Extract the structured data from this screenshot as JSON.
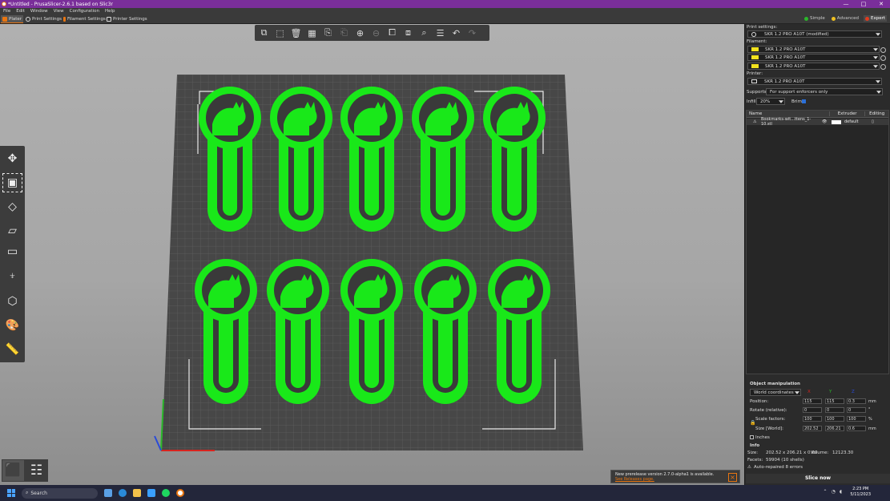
{
  "window": {
    "title": "*Untitled - PrusaSlicer-2.6.1 based on Slic3r",
    "controls": [
      "—",
      "□",
      "✕"
    ]
  },
  "menu": [
    "File",
    "Edit",
    "Window",
    "View",
    "Configuration",
    "Help"
  ],
  "tabs": [
    {
      "label": "Plater",
      "color": "#e87511"
    },
    {
      "label": "Print Settings",
      "color": "#dddddd"
    },
    {
      "label": "Filament Settings",
      "color": "#e87511"
    },
    {
      "label": "Printer Settings",
      "color": "#dddddd"
    }
  ],
  "modes": [
    {
      "label": "Simple",
      "color": "#2ab72a"
    },
    {
      "label": "Advanced",
      "color": "#f0c020"
    },
    {
      "label": "Expert",
      "color": "#e03a1e"
    }
  ],
  "print_settings": {
    "label": "Print settings:",
    "value": "SKR 1.2 PRO A10T (modified)"
  },
  "filament": {
    "label": "Filament:",
    "items": [
      "SKR 1.2 PRO A10T",
      "SKR 1.2 PRO A10T",
      "SKR 1.2 PRO A10T"
    ],
    "color": "#f2e21e"
  },
  "printer": {
    "label": "Printer:",
    "value": "SKR 1.2 PRO A10T"
  },
  "supports": {
    "label": "Supports:",
    "value": "For support enforcers only"
  },
  "infill": {
    "label": "Infill:",
    "value": "20%"
  },
  "brim": {
    "label": "Brim:",
    "checked": true
  },
  "object_list": {
    "columns": [
      "Name",
      "Extruder",
      "Editing"
    ],
    "rows": [
      {
        "name": "Bookmarks-wit...ttens_1-10.stl",
        "extruder": "default"
      }
    ]
  },
  "object_manipulation": {
    "title": "Object manipulation",
    "coord_system": "World coordinates",
    "axes": [
      "X",
      "Y",
      "Z"
    ],
    "rows": [
      {
        "label": "Position:",
        "values": [
          "115",
          "115",
          "0.3"
        ],
        "unit": "mm"
      },
      {
        "label": "Rotate (relative):",
        "values": [
          "0",
          "0",
          "0"
        ],
        "unit": "°"
      },
      {
        "label": "Scale factors:",
        "values": [
          "100",
          "100",
          "100"
        ],
        "unit": "%"
      },
      {
        "label": "Size [World]:",
        "values": [
          "202.52",
          "206.21",
          "0.6"
        ],
        "unit": "mm"
      }
    ],
    "inches_label": "Inches"
  },
  "info": {
    "title": "Info",
    "size_label": "Size:",
    "size_value": "202.52 x 206.21 x 0.60",
    "volume_label": "Volume:",
    "volume_value": "12123.30",
    "facets_label": "Facets:",
    "facets_value": "59904 (10 shells)",
    "repaired": "Auto-repaired 8 errors"
  },
  "slice_button": "Slice now",
  "notification": {
    "text": "New prerelease version 2.7.0-alpha1 is available.",
    "link": "See Releases page."
  },
  "taskbar": {
    "search_placeholder": "Search",
    "time": "2:23 PM",
    "date": "5/11/2023"
  },
  "colors": {
    "model": "#19e819",
    "bed": "#474747",
    "accent": "#e87511"
  }
}
